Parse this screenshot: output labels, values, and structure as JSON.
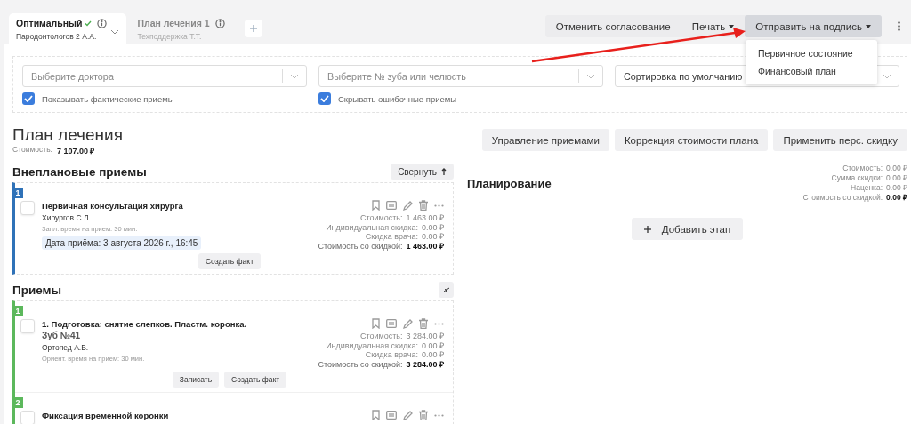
{
  "plan_tabs": [
    {
      "title": "Оптимальный",
      "approved": true,
      "subtitle": "Пародонтологов 2 А.А.",
      "selected": true
    },
    {
      "title": "План лечения 1",
      "approved": false,
      "subtitle": "Техподдержка Т.Т.",
      "selected": false
    }
  ],
  "toolbar": {
    "buttons": [
      {
        "label": "Отменить согласование",
        "has_caret": false,
        "active": false
      },
      {
        "label": "Печать",
        "has_caret": true,
        "active": false
      },
      {
        "label": "Отправить на подпись",
        "has_caret": true,
        "active": true
      }
    ]
  },
  "dropdown_menu": {
    "items": [
      "Первичное состояние",
      "Финансовый план"
    ]
  },
  "filters": {
    "selects": [
      {
        "placeholder": "Выберите доктора"
      },
      {
        "placeholder": "Выберите № зуба или челюсть"
      },
      {
        "value": "Сортировка по умолчанию"
      }
    ],
    "checkboxes": [
      {
        "label": "Показывать фактические приемы",
        "checked": true
      },
      {
        "label": "Скрывать ошибочные приемы",
        "checked": true
      }
    ]
  },
  "plan": {
    "title": "План лечения",
    "cost_label": "Стоимость:",
    "cost_value": "7 107.00 ₽",
    "actions": [
      "Управление приемами",
      "Коррекция стоимости плана",
      "Применить перс. скидку"
    ]
  },
  "sections": [
    {
      "title": "Внеплановые приемы",
      "collapse_label": "Свернуть",
      "color": "#2f72b8",
      "items": [
        {
          "number": "1",
          "checked": false,
          "title": "Первичная консультация хирурга",
          "doctor": "Хирургов С.Л.",
          "time_note": "Запл. время на прием: 30 мин.",
          "date": "Дата приёма: 3 августа 2026 г., 16:45",
          "prices": [
            {
              "label": "Стоимость:",
              "value": "1 463.00 ₽",
              "kind": "line"
            },
            {
              "label": "Индивидуальная скидка:",
              "value": "0.00 ₽",
              "kind": "line"
            },
            {
              "label": "Скидка врача:",
              "value": "0.00 ₽",
              "kind": "line"
            },
            {
              "label": "Стоимость со скидкой:",
              "value": "1 463.00 ₽",
              "kind": "total"
            }
          ],
          "buttons": [
            "Создать факт"
          ]
        }
      ]
    },
    {
      "title": "Приемы",
      "color": "#5cb85c",
      "items": [
        {
          "number": "1",
          "checked": false,
          "title": "1. Подготовка: снятие слепков. Пластм. коронка.",
          "tooth": "Зуб №41",
          "doctor": "Ортопед А.В.",
          "time_note": "Ориент. время на прием: 30 мин.",
          "prices": [
            {
              "label": "Стоимость:",
              "value": "3 284.00 ₽",
              "kind": "line"
            },
            {
              "label": "Индивидуальная скидка:",
              "value": "0.00 ₽",
              "kind": "line"
            },
            {
              "label": "Скидка врача:",
              "value": "0.00 ₽",
              "kind": "line"
            },
            {
              "label": "Стоимость со скидкой:",
              "value": "3 284.00 ₽",
              "kind": "total"
            }
          ],
          "buttons": [
            "Записать",
            "Создать факт"
          ]
        },
        {
          "number": "2",
          "checked": false,
          "title": "Фиксация временной коронки"
        }
      ]
    }
  ],
  "planning": {
    "title": "Планирование",
    "summary": [
      {
        "label": "Стоимость:",
        "value": "0.00 ₽",
        "kind": "line"
      },
      {
        "label": "Сумма скидки:",
        "value": "0.00 ₽",
        "kind": "line"
      },
      {
        "label": "Наценка:",
        "value": "0.00 ₽",
        "kind": "line"
      },
      {
        "label": "Стоимость со скидкой:",
        "value": "0.00 ₽",
        "kind": "total"
      }
    ],
    "add_stage_button": "Добавить этап"
  }
}
